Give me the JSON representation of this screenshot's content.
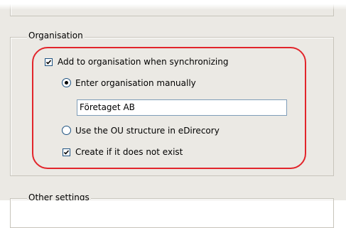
{
  "organisation": {
    "legend": "Organisation",
    "add_to_org": {
      "label": "Add to organisation when synchronizing",
      "checked": true
    },
    "enter_manually": {
      "label": "Enter organisation manually",
      "selected": true
    },
    "org_name": {
      "value": "Företaget AB"
    },
    "use_ou": {
      "label": "Use the OU structure in eDirecory",
      "selected": false
    },
    "create_if_missing": {
      "label": "Create if it does not exist",
      "checked": true
    }
  },
  "other_settings": {
    "legend": "Other settings"
  },
  "colors": {
    "highlight": "#e2252b",
    "panel": "#ebe9e4",
    "control_border": "#1c5180"
  }
}
